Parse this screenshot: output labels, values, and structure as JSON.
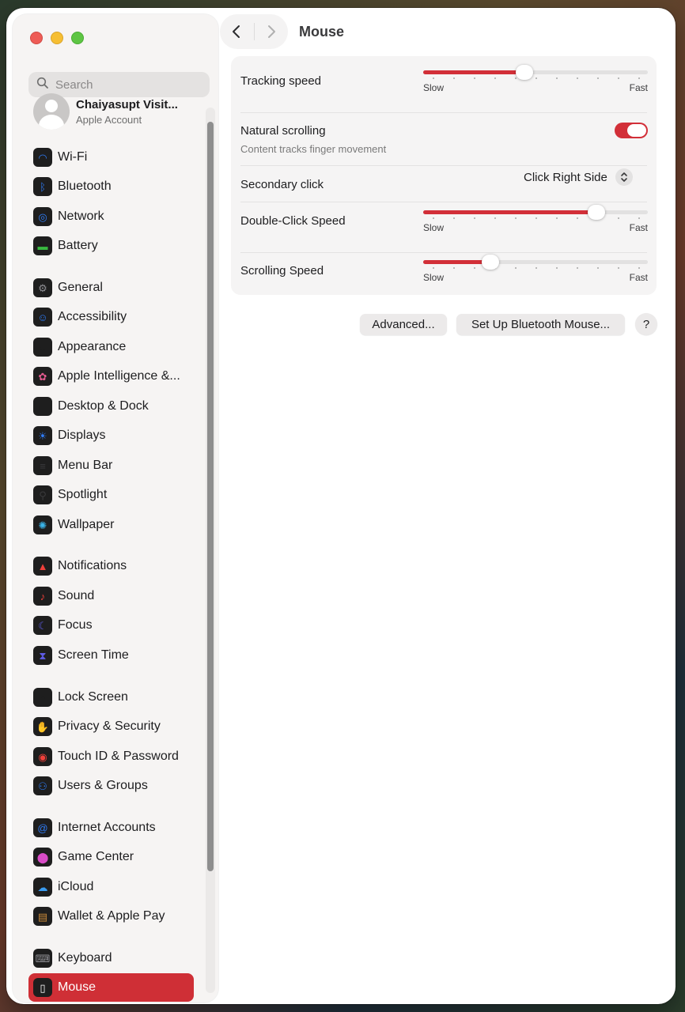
{
  "window": {
    "title": "Mouse"
  },
  "sidebar": {
    "search_placeholder": "Search",
    "account": {
      "name": "Chaiyasupt Visit...",
      "subtitle": "Apple Account"
    },
    "items": [
      {
        "label": "Wi-Fi",
        "icon": "wifi-icon",
        "color": "#2f7cf6",
        "glyph": "◠"
      },
      {
        "label": "Bluetooth",
        "icon": "bluetooth-icon",
        "color": "#2f7cf6",
        "glyph": "ᛒ"
      },
      {
        "label": "Network",
        "icon": "globe-icon",
        "color": "#2f7cf6",
        "glyph": "◎"
      },
      {
        "label": "Battery",
        "icon": "battery-icon",
        "color": "#38b940",
        "glyph": "▬"
      },
      {
        "label": "General",
        "icon": "gear-icon",
        "color": "#8e8e93",
        "glyph": "⚙"
      },
      {
        "label": "Accessibility",
        "icon": "accessibility-icon",
        "color": "#2f7cf6",
        "glyph": "☺"
      },
      {
        "label": "Appearance",
        "icon": "appearance-icon",
        "color": "#1e1e1e",
        "glyph": "◐"
      },
      {
        "label": "Apple Intelligence &...",
        "icon": "apple-intelligence-icon",
        "color": "#e35b8f",
        "glyph": "✿"
      },
      {
        "label": "Desktop & Dock",
        "icon": "dock-icon",
        "color": "#1e1e1e",
        "glyph": "▭"
      },
      {
        "label": "Displays",
        "icon": "display-brightness-icon",
        "color": "#2f7cf6",
        "glyph": "☀"
      },
      {
        "label": "Menu Bar",
        "icon": "menu-bar-icon",
        "color": "#3a3a3c",
        "glyph": "≡"
      },
      {
        "label": "Spotlight",
        "icon": "spotlight-icon",
        "color": "#3a3a3c",
        "glyph": "⚲"
      },
      {
        "label": "Wallpaper",
        "icon": "wallpaper-icon",
        "color": "#3ab3e8",
        "glyph": "✺"
      },
      {
        "label": "Notifications",
        "icon": "bell-icon",
        "color": "#f0403a",
        "glyph": "▲"
      },
      {
        "label": "Sound",
        "icon": "speaker-icon",
        "color": "#f0403a",
        "glyph": "♪"
      },
      {
        "label": "Focus",
        "icon": "moon-icon",
        "color": "#5e5ce6",
        "glyph": "☾"
      },
      {
        "label": "Screen Time",
        "icon": "hourglass-icon",
        "color": "#5e5ce6",
        "glyph": "⧗"
      },
      {
        "label": "Lock Screen",
        "icon": "lock-icon",
        "color": "#1e1e1e",
        "glyph": "⌂"
      },
      {
        "label": "Privacy & Security",
        "icon": "hand-icon",
        "color": "#2f7cf6",
        "glyph": "✋"
      },
      {
        "label": "Touch ID & Password",
        "icon": "fingerprint-icon",
        "color": "#f0403a",
        "glyph": "◉"
      },
      {
        "label": "Users & Groups",
        "icon": "users-icon",
        "color": "#2f7cf6",
        "glyph": "⚇"
      },
      {
        "label": "Internet Accounts",
        "icon": "at-sign-icon",
        "color": "#2f7cf6",
        "glyph": "@"
      },
      {
        "label": "Game Center",
        "icon": "game-center-icon",
        "color": "#d94cc7",
        "glyph": "⬤"
      },
      {
        "label": "iCloud",
        "icon": "cloud-icon",
        "color": "#3a9cf0",
        "glyph": "☁"
      },
      {
        "label": "Wallet & Apple Pay",
        "icon": "wallet-icon",
        "color": "#c98a3a",
        "glyph": "▤"
      },
      {
        "label": "Keyboard",
        "icon": "keyboard-icon",
        "color": "#8e8e93",
        "glyph": "⌨"
      },
      {
        "label": "Mouse",
        "icon": "mouse-icon",
        "color": "#3a3a3c",
        "glyph": "▯",
        "selected": true
      }
    ]
  },
  "settings": {
    "tracking_speed": {
      "label": "Tracking speed",
      "low": "Slow",
      "high": "Fast",
      "level": 0.45
    },
    "natural_scrolling": {
      "label": "Natural scrolling",
      "subtitle": "Content tracks finger movement",
      "on": true
    },
    "secondary_click": {
      "label": "Secondary click",
      "value": "Click Right Side"
    },
    "double_click_speed": {
      "label": "Double-Click Speed",
      "low": "Slow",
      "high": "Fast",
      "level": 0.77
    },
    "scrolling_speed": {
      "label": "Scrolling Speed",
      "low": "Slow",
      "high": "Fast",
      "level": 0.3
    }
  },
  "buttons": {
    "advanced": "Advanced...",
    "setup_bluetooth": "Set Up Bluetooth Mouse...",
    "help": "?"
  },
  "colors": {
    "accent": "#d22f38",
    "selected_bg": "#cf2f36"
  }
}
